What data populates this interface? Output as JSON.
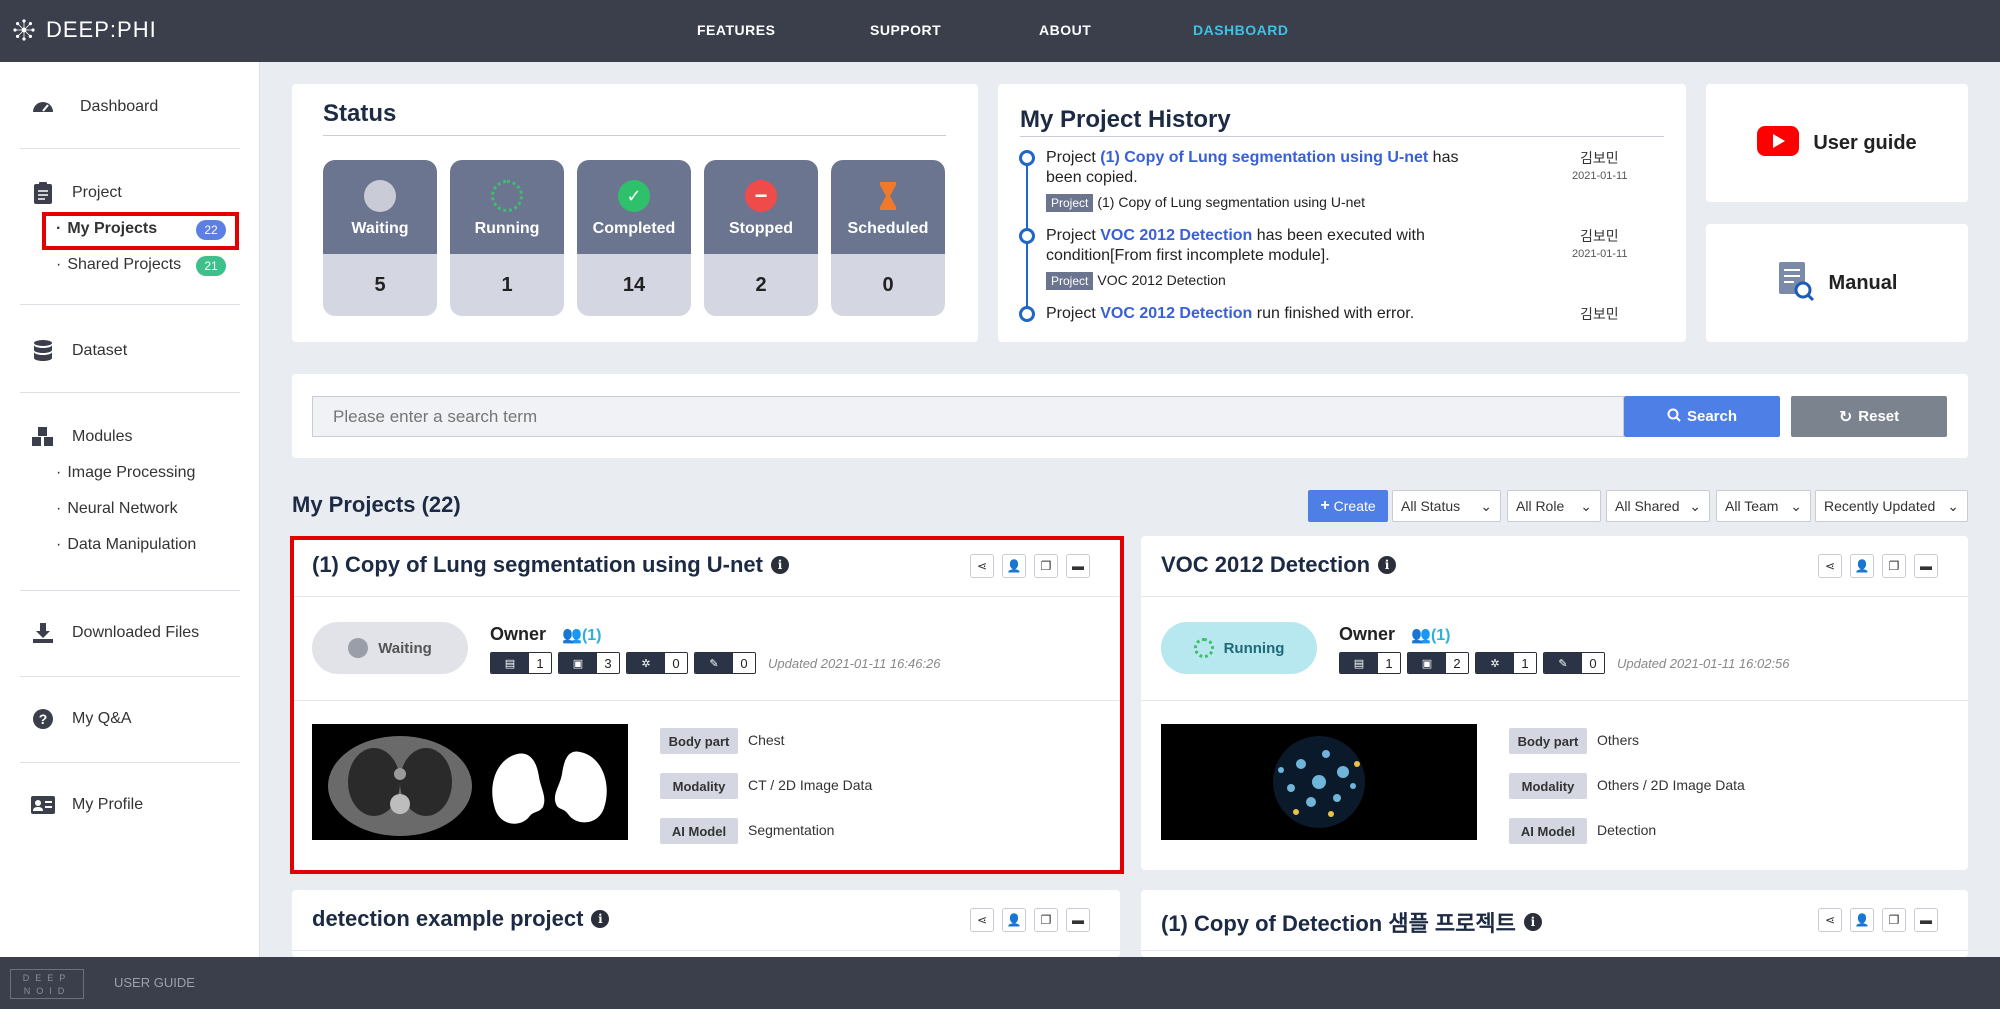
{
  "nav": {
    "logo": "DEEP:PHI",
    "links": [
      "FEATURES",
      "SUPPORT",
      "ABOUT",
      "DASHBOARD"
    ]
  },
  "sidebar": {
    "dashboard": "Dashboard",
    "project": "Project",
    "my_projects": "My Projects",
    "my_projects_count": "22",
    "shared_projects": "Shared Projects",
    "shared_projects_count": "21",
    "dataset": "Dataset",
    "modules": "Modules",
    "image_processing": "Image Processing",
    "neural_network": "Neural Network",
    "data_manipulation": "Data Manipulation",
    "downloaded_files": "Downloaded Files",
    "my_qa": "My Q&A",
    "my_profile": "My Profile"
  },
  "status": {
    "title": "Status",
    "tiles": [
      {
        "label": "Waiting",
        "count": "5",
        "color": "#c9ccd6"
      },
      {
        "label": "Running",
        "count": "1",
        "color": "#3cc06a"
      },
      {
        "label": "Completed",
        "count": "14",
        "color": "#2ec06a"
      },
      {
        "label": "Stopped",
        "count": "2",
        "color": "#ef4b4b"
      },
      {
        "label": "Scheduled",
        "count": "0",
        "color": "#f07a2a"
      }
    ]
  },
  "history": {
    "title": "My Project History",
    "items": [
      {
        "pre": "Project ",
        "link": "(1) Copy of Lung segmentation using U-net",
        "post": " has been copied.",
        "tag": "Project",
        "tag_text": "(1) Copy of Lung segmentation using U-net",
        "user": "김보민",
        "date": "2021-01-11"
      },
      {
        "pre": "Project ",
        "link": "VOC 2012 Detection",
        "post": " has been executed with condition[From first incomplete module].",
        "tag": "Project",
        "tag_text": "VOC 2012 Detection",
        "user": "김보민",
        "date": "2021-01-11"
      },
      {
        "pre": "Project ",
        "link": "VOC 2012 Detection",
        "post": " run finished with error.",
        "user": "김보민"
      }
    ]
  },
  "side_cards": {
    "user_guide": "User guide",
    "manual": "Manual"
  },
  "search": {
    "placeholder": "Please enter a search term",
    "search_label": "Search",
    "reset_label": "Reset"
  },
  "projects": {
    "heading": "My Projects (22)",
    "create_label": "Create",
    "filters": [
      "All Status",
      "All Role",
      "All Shared",
      "All Team",
      "Recently Updated"
    ],
    "cards": [
      {
        "title": "(1) Copy of Lung segmentation using U-net",
        "status": "Waiting",
        "owner": "Owner",
        "team": "(1)",
        "stats": [
          "1",
          "3",
          "0",
          "0"
        ],
        "updated": "Updated 2021-01-11 16:46:26",
        "body_part_label": "Body part",
        "body_part": "Chest",
        "modality_label": "Modality",
        "modality": "CT / 2D Image Data",
        "ai_model_label": "AI Model",
        "ai_model": "Segmentation"
      },
      {
        "title": "VOC 2012 Detection",
        "status": "Running",
        "owner": "Owner",
        "team": "(1)",
        "stats": [
          "1",
          "2",
          "1",
          "0"
        ],
        "updated": "Updated 2021-01-11 16:02:56",
        "body_part_label": "Body part",
        "body_part": "Others",
        "modality_label": "Modality",
        "modality": "Others / 2D Image Data",
        "ai_model_label": "AI Model",
        "ai_model": "Detection"
      },
      {
        "title": "detection example project"
      },
      {
        "title": "(1) Copy of Detection 샘플 프로젝트"
      }
    ]
  },
  "footer": {
    "logo": "DEEP NOID",
    "user_guide": "USER GUIDE"
  }
}
